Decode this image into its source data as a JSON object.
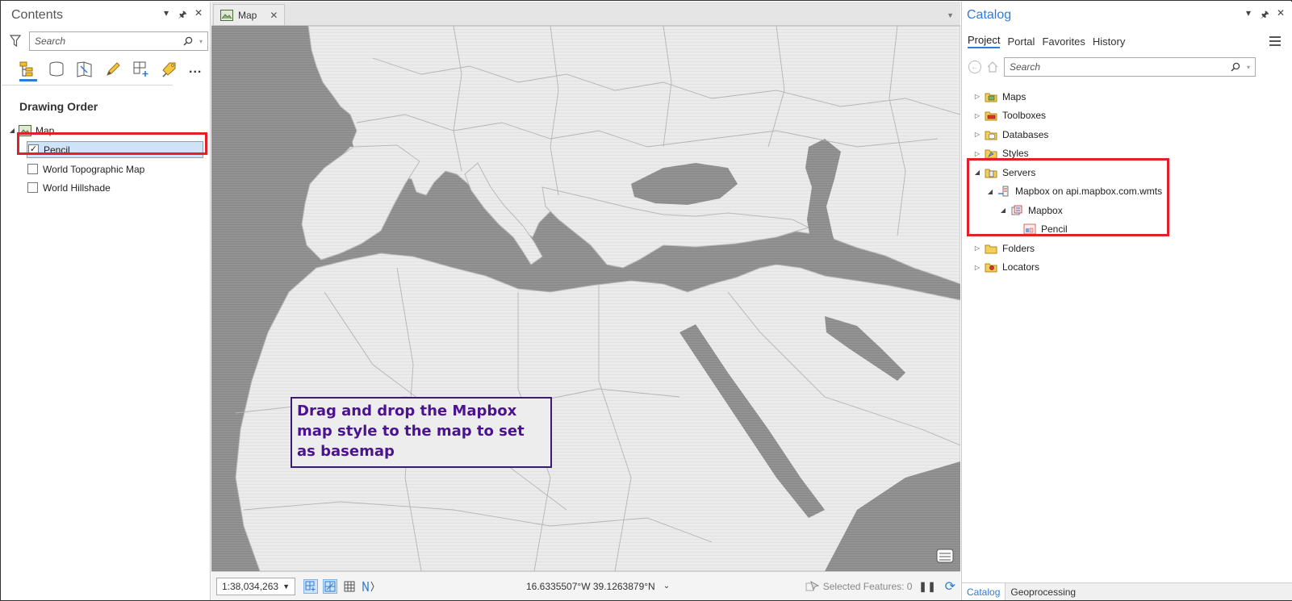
{
  "contents": {
    "title": "Contents",
    "search_placeholder": "Search",
    "drawing_order_label": "Drawing Order",
    "more_label": "...",
    "map_node": "Map",
    "layers": [
      {
        "label": "Pencil",
        "checked": true,
        "selected": true
      },
      {
        "label": "World Topographic Map",
        "checked": false,
        "selected": false
      },
      {
        "label": "World Hillshade",
        "checked": false,
        "selected": false
      }
    ]
  },
  "map_view": {
    "tab_label": "Map",
    "callout_text": "Drag and drop the Mapbox map style to the map to set as basemap",
    "status": {
      "scale": "1:38,034,263",
      "coordinates": "16.6335507°W 39.1263879°N",
      "selected_features": "Selected Features: 0"
    }
  },
  "catalog": {
    "title": "Catalog",
    "tabs": [
      "Project",
      "Portal",
      "Favorites",
      "History"
    ],
    "active_tab": "Project",
    "search_placeholder": "Search",
    "items": [
      {
        "label": "Maps",
        "icon": "maps-folder-icon"
      },
      {
        "label": "Toolboxes",
        "icon": "toolbox-folder-icon"
      },
      {
        "label": "Databases",
        "icon": "database-folder-icon"
      },
      {
        "label": "Styles",
        "icon": "styles-folder-icon"
      },
      {
        "label": "Servers",
        "icon": "servers-folder-icon"
      },
      {
        "label": "Mapbox on api.mapbox.com.wmts",
        "icon": "wmts-server-icon"
      },
      {
        "label": "Mapbox",
        "icon": "wmts-layer-group-icon"
      },
      {
        "label": "Pencil",
        "icon": "wmts-layer-icon"
      },
      {
        "label": "Folders",
        "icon": "folder-icon"
      },
      {
        "label": "Locators",
        "icon": "locators-folder-icon"
      }
    ],
    "bottom_tabs": [
      "Catalog",
      "Geoprocessing"
    ]
  },
  "colors": {
    "accent": "#2d7cd6",
    "highlight_box": "#e0202a",
    "callout_border": "#3b1c6e",
    "callout_text": "#4b1390",
    "land": "#ececec",
    "water": "#8f8f8f"
  }
}
